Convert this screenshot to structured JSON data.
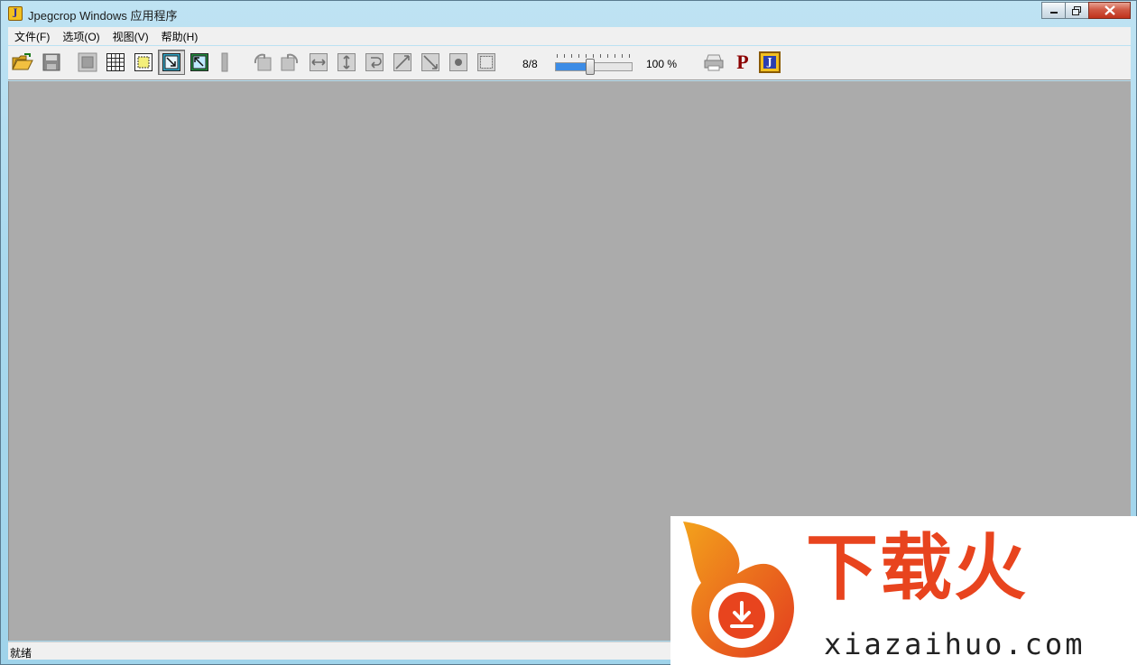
{
  "window": {
    "title": "Jpegcrop Windows 应用程序",
    "icon_letter": "J"
  },
  "menu": {
    "items": [
      "文件(F)",
      "选项(O)",
      "视图(V)",
      "帮助(H)"
    ]
  },
  "toolbar": {
    "page_indicator": "8/8",
    "zoom_label": "100 %",
    "quality_slider_fraction": 0.45,
    "icons": [
      "open-folder-icon",
      "save-icon",
      "grayscale-icon",
      "grid-icon",
      "crop-select-icon",
      "fit-window-icon",
      "zoom-fit-icon",
      "progressive-icon",
      "rotate-left-icon",
      "rotate-right-icon",
      "flip-horizontal-icon",
      "flip-vertical-icon",
      "rotate-180-icon",
      "transpose-icon",
      "transverse-icon",
      "drop-icon",
      "trim-icon",
      "print-icon",
      "p-icon",
      "about-icon"
    ],
    "p_label": "P",
    "about_label": "J"
  },
  "status": {
    "text": "就绪"
  },
  "watermark": {
    "brand": "下载火",
    "url": "xiazaihuo.com",
    "accent": "#e8441e"
  },
  "colors": {
    "canvas": "#ababab",
    "chrome": "#f0f0f0",
    "title_gradient": "#a9d9ee"
  }
}
